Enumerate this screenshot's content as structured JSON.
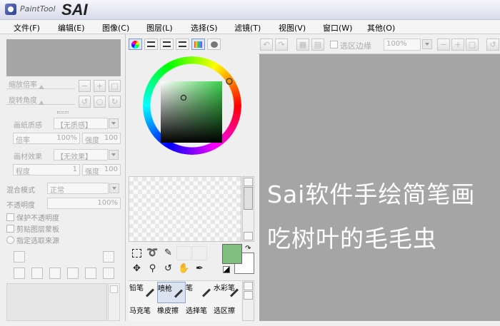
{
  "app": {
    "logo_text": "PaintTool",
    "logo_brand": "SAI"
  },
  "menu": [
    "文件(F)",
    "编辑(E)",
    "图像(C)",
    "图层(L)",
    "选择(S)",
    "滤镜(T)",
    "视图(V)",
    "窗口(W)",
    "其他(O)"
  ],
  "nav": {
    "zoom_label": "缩放倍率",
    "rotate_label": "旋转角度"
  },
  "paper": {
    "texture_label": "画纸质感",
    "texture_value": "【无质感】",
    "scale_label": "倍率",
    "scale_value": "100%",
    "strength_label": "强度",
    "strength_value": "100"
  },
  "effect": {
    "label": "画材效果",
    "value": "【无效果】",
    "degree_label": "程度",
    "degree_value": "1",
    "strength_label": "强度",
    "strength_value": "100"
  },
  "layer": {
    "blend_label": "混合模式",
    "blend_value": "正常",
    "opacity_label": "不透明度",
    "opacity_value": "100%",
    "preserve_opacity": "保护不透明度",
    "clip_group": "剪贴图层蒙板",
    "selection_source": "指定选取来源"
  },
  "toolbar": {
    "selection_edge_label": "选区边缘",
    "zoom_value": "100%"
  },
  "colors": {
    "primary": "#7fbf7f",
    "secondary": "#ffffff"
  },
  "icons": [
    "marquee-icon",
    "lasso-icon",
    "magic-wand-icon",
    "move-icon",
    "zoom-icon",
    "rotate-icon",
    "hand-icon",
    "eyedropper-icon",
    "undo-icon",
    "redo-icon"
  ],
  "brushes": [
    {
      "label": "铅笔"
    },
    {
      "label": "喷枪"
    },
    {
      "label": "笔"
    },
    {
      "label": "水彩笔"
    },
    {
      "label": "马克笔"
    },
    {
      "label": "橡皮擦"
    },
    {
      "label": "选择笔"
    },
    {
      "label": "选区擦"
    }
  ],
  "overlay": {
    "line1": "Sai软件手绘简笔画",
    "line2": "吃树叶的毛毛虫"
  }
}
